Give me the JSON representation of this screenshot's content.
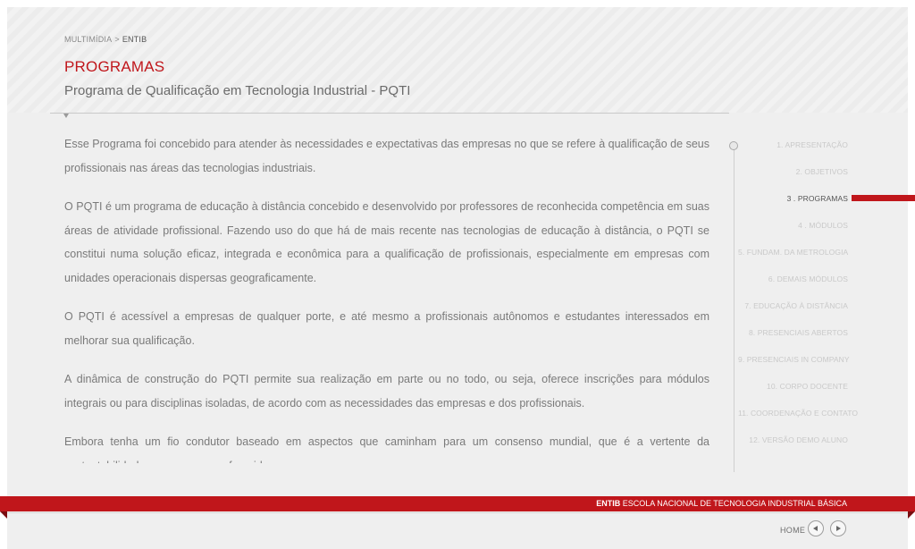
{
  "breadcrumb": {
    "parent": "MULTIMÍDIA",
    "separator": ">",
    "current": "ENTIB"
  },
  "header": {
    "section_title": "PROGRAMAS",
    "page_title": "Programa de Qualificação em Tecnologia Industrial - PQTI"
  },
  "content": {
    "paragraphs": [
      "Esse Programa foi concebido para atender às necessidades e expectativas das empresas no que se refere à qualificação de seus profissionais nas áreas das tecnologias industriais.",
      "O PQTI é um programa de educação à distância concebido e desenvolvido por professores de reconhecida competência em suas áreas de atividade profissional. Fazendo uso do que há de mais recente nas tecnologias de educação à distância, o PQTI se constitui numa solução eficaz, integrada e econômica para a qualificação de profissionais, especialmente em empresas com unidades operacionais dispersas geograficamente.",
      "O PQTI é acessível a empresas de qualquer porte, e até mesmo a profissionais autônomos e estudantes interessados em melhorar sua qualificação.",
      "A dinâmica de construção do PQTI permite sua realização em parte ou no todo, ou seja, oferece inscrições para módulos integrais ou para disciplinas isoladas, de acordo com as necessidades das empresas e dos profissionais.",
      "Embora tenha um fio condutor baseado em aspectos que caminham para um consenso mundial, que é a vertente da sustentabilidade, os programas oferecidos"
    ]
  },
  "sidebar": {
    "items": [
      {
        "label": "1. APRESENTAÇÃO"
      },
      {
        "label": "2. OBJETIVOS"
      },
      {
        "label": "3 . PROGRAMAS"
      },
      {
        "label": "4 . MÓDULOS"
      },
      {
        "label": "5. FUNDAM. DA METROLOGIA"
      },
      {
        "label": "6. DEMAIS MÓDULOS"
      },
      {
        "label": "7. EDUCAÇÃO À DISTÂNCIA"
      },
      {
        "label": "8. PRESENCIAIS ABERTOS"
      },
      {
        "label": "9. PRESENCIAIS IN COMPANY"
      },
      {
        "label": "10. CORPO DOCENTE"
      },
      {
        "label": "11. COORDENAÇÃO E CONTATO"
      },
      {
        "label": "12. VERSÃO DEMO ALUNO"
      }
    ],
    "active_index": 2
  },
  "footer": {
    "org_abbr": "ENTIB",
    "org_name": "ESCOLA NACIONAL DE TECNOLOGIA INDUSTRIAL BÁSICA",
    "home_label": "HOME"
  },
  "colors": {
    "accent": "#c0161b",
    "text": "#7a7a7a",
    "inactive_nav": "#c9c9c9",
    "background": "#efefef"
  },
  "icons": {
    "prev": "arrow-left-icon",
    "next": "arrow-right-icon",
    "scroll": "scroll-knob-icon",
    "title_marker": "triangle-down-icon"
  }
}
